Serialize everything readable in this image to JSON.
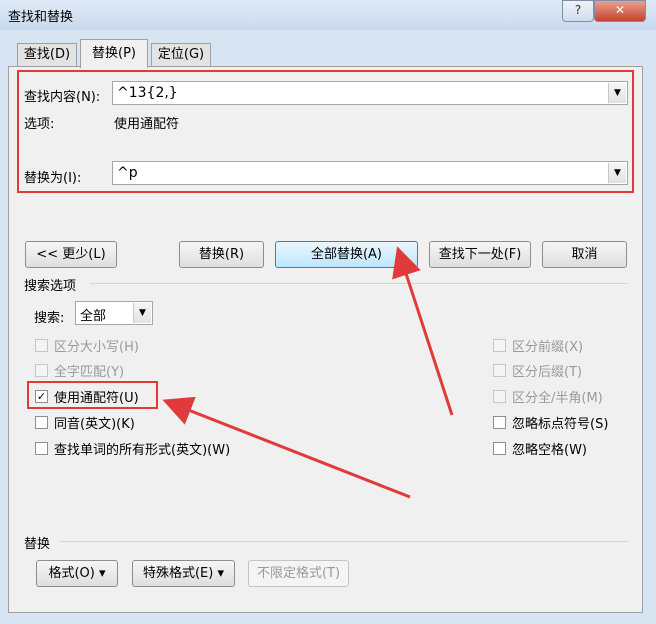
{
  "window": {
    "title": "查找和替换",
    "help_label": "?",
    "close_label": "✕"
  },
  "tabs": [
    {
      "label": "查找(D)",
      "active": false
    },
    {
      "label": "替换(P)",
      "active": true
    },
    {
      "label": "定位(G)",
      "active": false
    }
  ],
  "find": {
    "label": "查找内容(N):",
    "value": "^13{2,}",
    "options_label": "选项:",
    "options_value": "使用通配符"
  },
  "replace": {
    "label": "替换为(I):",
    "value": "^p"
  },
  "buttons": {
    "less": "<< 更少(L)",
    "replace": "替换(R)",
    "replace_all": "全部替换(A)",
    "find_next": "查找下一处(F)",
    "cancel": "取消"
  },
  "search_options": {
    "heading": "搜索选项",
    "search_label": "搜索:",
    "search_value": "全部",
    "left": [
      {
        "label": "区分大小写(H)",
        "checked": false,
        "enabled": false
      },
      {
        "label": "全字匹配(Y)",
        "checked": false,
        "enabled": false
      },
      {
        "label": "使用通配符(U)",
        "checked": true,
        "enabled": true
      },
      {
        "label": "同音(英文)(K)",
        "checked": false,
        "enabled": true
      },
      {
        "label": "查找单词的所有形式(英文)(W)",
        "checked": false,
        "enabled": true
      }
    ],
    "right": [
      {
        "label": "区分前缀(X)",
        "checked": false,
        "enabled": false
      },
      {
        "label": "区分后缀(T)",
        "checked": false,
        "enabled": false
      },
      {
        "label": "区分全/半角(M)",
        "checked": false,
        "enabled": false
      },
      {
        "label": "忽略标点符号(S)",
        "checked": false,
        "enabled": true
      },
      {
        "label": "忽略空格(W)",
        "checked": false,
        "enabled": true
      }
    ]
  },
  "replace_section": {
    "heading": "替换",
    "format": "格式(O) ▾",
    "special": "特殊格式(E) ▾",
    "no_format": "不限定格式(T)"
  },
  "colors": {
    "annotation": "#e03a3a",
    "accent": "#3c7fb1"
  }
}
